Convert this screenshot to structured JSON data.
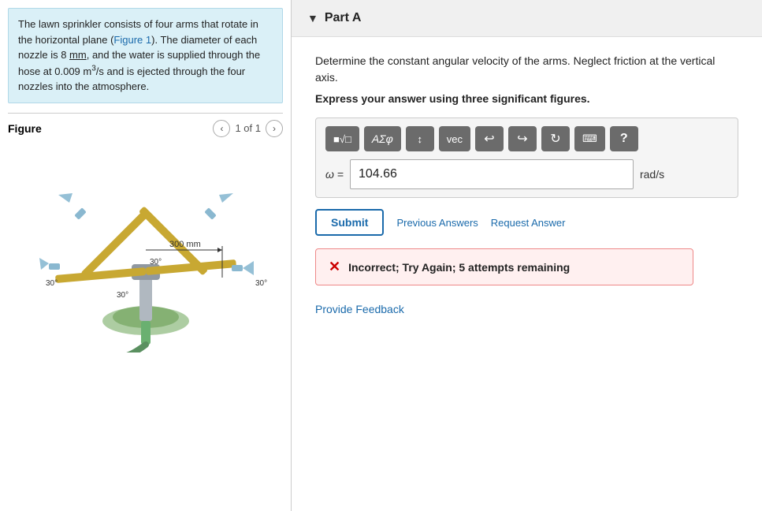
{
  "left": {
    "description": {
      "text_parts": [
        "The lawn sprinkler consists of four arms that rotate in the horizontal plane (",
        "Figure 1",
        "). The diameter of each nozzle is 8 mm, and the water is supplied through the hose at 0.009 m",
        "3",
        "/s and is ejected through the four nozzles into the atmosphere."
      ],
      "figure_link": "Figure 1"
    },
    "figure": {
      "label": "Figure",
      "nav_text": "1 of 1"
    }
  },
  "right": {
    "part": {
      "title": "Part A",
      "question": "Determine the constant angular velocity of the arms. Neglect friction at the vertical axis.",
      "express": "Express your answer using three significant figures.",
      "toolbar": {
        "btn_matrix": "■√□",
        "btn_symbol": "AΣφ",
        "btn_updown": "↕",
        "btn_vec": "vec",
        "btn_undo": "↩",
        "btn_redo": "↪",
        "btn_refresh": "↺",
        "btn_keyboard": "⌨",
        "btn_help": "?"
      },
      "input": {
        "omega_label": "ω =",
        "value": "104.66",
        "unit": "rad/s"
      },
      "actions": {
        "submit": "Submit",
        "previous_answers": "Previous Answers",
        "request_answer": "Request Answer"
      },
      "error": {
        "icon": "✕",
        "message": "Incorrect; Try Again; 5 attempts remaining"
      }
    },
    "feedback_link": "Provide Feedback"
  }
}
